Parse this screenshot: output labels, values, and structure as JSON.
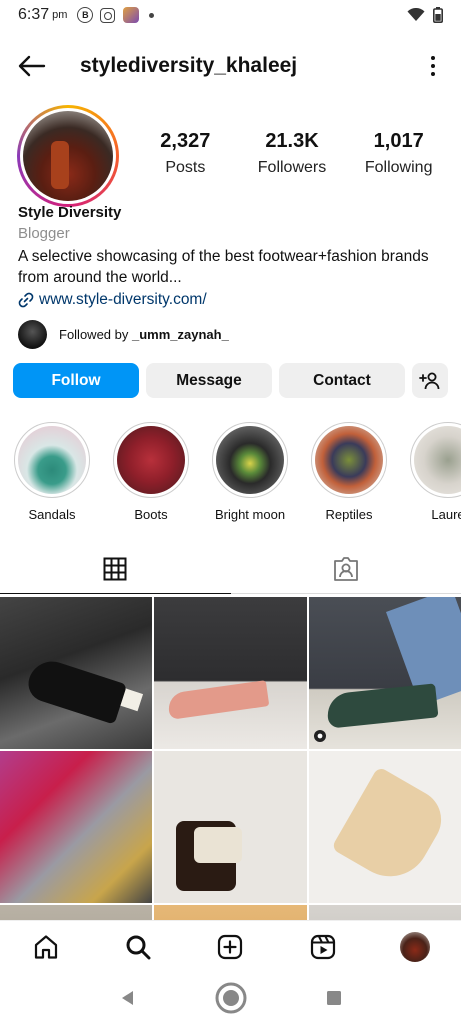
{
  "status_bar": {
    "time": "6:37",
    "ampm": "pm",
    "b_icon_letter": "B"
  },
  "header": {
    "username": "stylediversity_khaleej"
  },
  "profile": {
    "stats": [
      {
        "value": "2,327",
        "label": "Posts"
      },
      {
        "value": "21.3K",
        "label": "Followers"
      },
      {
        "value": "1,017",
        "label": "Following"
      }
    ],
    "name": "Style Diversity",
    "category": "Blogger",
    "bio": "A selective showcasing of the best footwear+fashion brands from around the world...",
    "link": "www.style-diversity.com/",
    "followed_by_prefix": "Followed by ",
    "followed_by_user": "_umm_zaynah_"
  },
  "buttons": {
    "follow": "Follow",
    "message": "Message",
    "contact": "Contact"
  },
  "highlights": [
    {
      "label": "Sandals",
      "colors": [
        "#d9e7e6",
        "#2c8a7a"
      ]
    },
    {
      "label": "Boots",
      "colors": [
        "#b8303b",
        "#6a1a22"
      ]
    },
    {
      "label": "Bright moon",
      "colors": [
        "#3a3a3a",
        "#d8d24a"
      ]
    },
    {
      "label": "Reptiles",
      "colors": [
        "#3a3b5a",
        "#7b8f3a"
      ]
    },
    {
      "label": "Laure",
      "colors": [
        "#d7d3cc",
        "#9aa08f"
      ]
    }
  ],
  "tabs": [
    {
      "name": "grid-icon",
      "active": true
    },
    {
      "name": "tagged-icon",
      "active": false
    }
  ],
  "colors": {
    "follow_blue": "#0095f6",
    "link_blue": "#00376b",
    "muted": "#8e8e8e"
  }
}
